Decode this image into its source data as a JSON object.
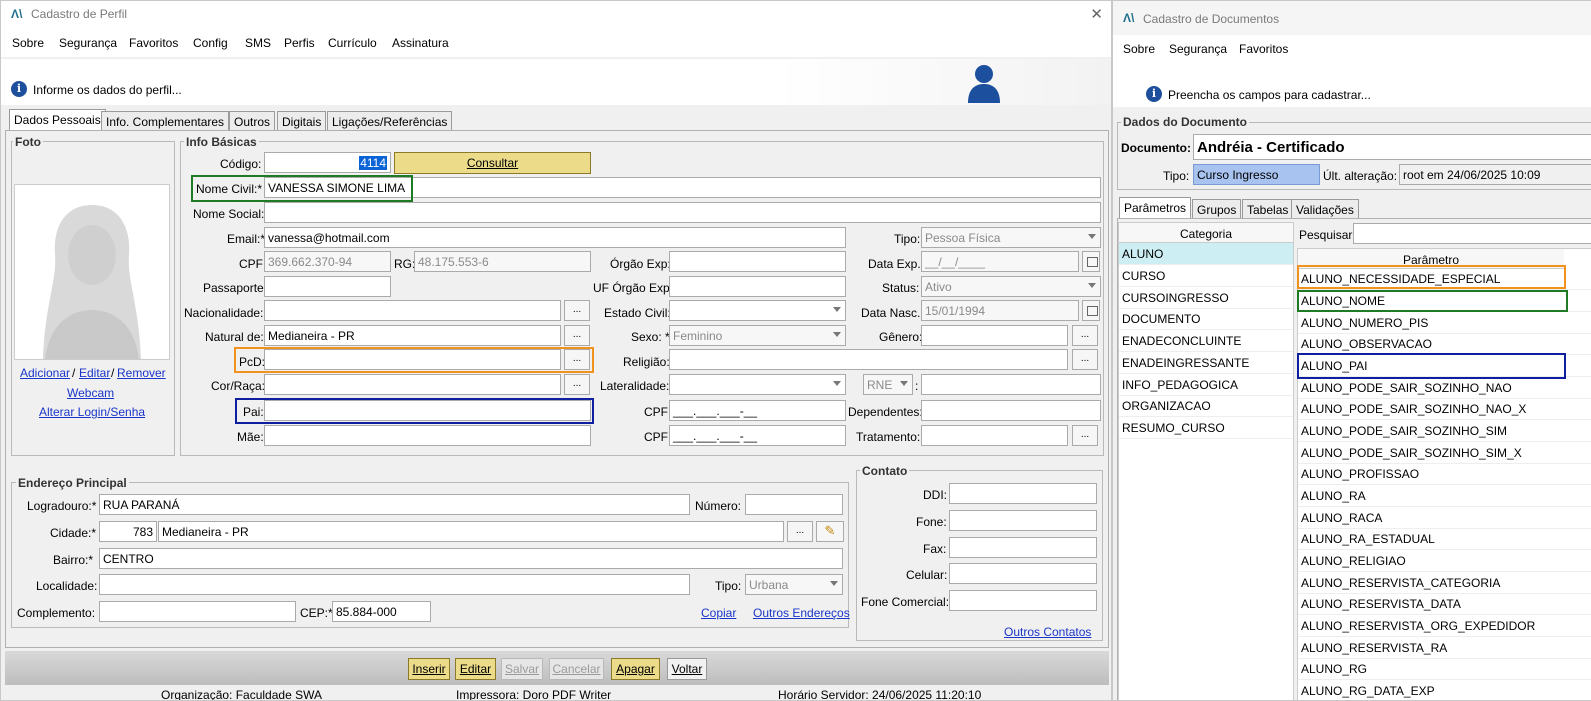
{
  "left_window": {
    "title": "Cadastro de Perfil",
    "logo": "Λ\\",
    "close": "✕",
    "menu": [
      "Sobre",
      "Segurança",
      "Favoritos",
      "Config",
      "SMS",
      "Perfis",
      "Currículo",
      "Assinatura"
    ],
    "info_text": "Informe os dados do perfil...",
    "tabs": [
      "Dados Pessoais",
      "Info. Complementares",
      "Outros",
      "Digitais",
      "Ligações/Referências"
    ],
    "foto": {
      "legend": "Foto",
      "links": {
        "adicionar": "Adicionar",
        "sep1": "/",
        "editar": "Editar",
        "sep2": "/",
        "remover": "Remover",
        "webcam": "Webcam",
        "alterar": "Alterar Login/Senha"
      }
    },
    "info_basicas": {
      "legend": "Info Básicas",
      "codigo_label": "Código:",
      "codigo_value": "4114",
      "consultar": "Consultar",
      "nome_civil_label": "Nome Civil:*",
      "nome_civil_value": "VANESSA SIMONE LIMA",
      "nome_social_label": "Nome Social:",
      "email_label": "Email:*",
      "email_value": "vanessa@hotmail.com",
      "tipo_label": "Tipo:",
      "tipo_value": "Pessoa Física",
      "cpf_label": "CPF:",
      "cpf_value": "369.662.370-94",
      "rg_label": "RG:",
      "rg_value": "48.175.553-6",
      "orgao_exp_label": "Órgão Exp:",
      "data_exp_label": "Data Exp.:",
      "data_exp_value": "__/__/____",
      "passaporte_label": "Passaporte:",
      "uf_orgao_label": "UF Órgão Exp:",
      "status_label": "Status:",
      "status_value": "Ativo",
      "nacionalidade_label": "Nacionalidade:",
      "estado_civil_label": "Estado Civil:",
      "data_nasc_label": "Data Nasc.:",
      "data_nasc_value": "15/01/1994",
      "natural_label": "Natural de:",
      "natural_value": "Medianeira - PR",
      "sexo_label": "Sexo: *",
      "sexo_value": "Feminino",
      "genero_label": "Gênero:",
      "pcd_label": "PcD:",
      "religiao_label": "Religião:",
      "cor_label": "Cor/Raça:",
      "lateralidade_label": "Lateralidade:",
      "rne_value": "RNE",
      "colon": ":",
      "pai_label": "Pai:",
      "cpf2_label": "CPF:",
      "cpf_mask": "___.___.___-__",
      "dependentes_label": "Dependentes:",
      "mae_label": "Mãe:",
      "cpf3_label": "CPF:",
      "tratamento_label": "Tratamento:",
      "dots": "..."
    },
    "endereco": {
      "legend": "Endereço Principal",
      "logradouro_label": "Logradouro:*",
      "logradouro_value": "RUA PARANÁ",
      "numero_label": "Número:",
      "cidade_label": "Cidade:*",
      "cidade_code": "783",
      "cidade_value": "Medianeira - PR",
      "bairro_label": "Bairro:*",
      "bairro_value": "CENTRO",
      "localidade_label": "Localidade:",
      "tipo_label": "Tipo:",
      "tipo_value": "Urbana",
      "complemento_label": "Complemento:",
      "cep_label": "CEP:*",
      "cep_value": "85.884-000",
      "copiar": "Copiar",
      "outros": "Outros Endereços"
    },
    "contato": {
      "legend": "Contato",
      "ddi": "DDI:",
      "fone": "Fone:",
      "fax": "Fax:",
      "celular": "Celular:",
      "fone_comercial": "Fone Comercial:",
      "outros": "Outros Contatos"
    },
    "buttons": {
      "inserir": "Inserir",
      "editar": "Editar",
      "salvar": "Salvar",
      "cancelar": "Cancelar",
      "apagar": "Apagar",
      "voltar": "Voltar"
    },
    "status_bar": {
      "org": "Organização: Faculdade SWA",
      "impressora": "Impressora: Doro PDF Writer",
      "horario": "Horário Servidor: 24/06/2025 11:20:10"
    }
  },
  "right_window": {
    "title": "Cadastro de Documentos",
    "logo": "Λ\\",
    "menu": [
      "Sobre",
      "Segurança",
      "Favoritos"
    ],
    "info_text": "Preencha os campos para cadastrar...",
    "dados_legend": "Dados do Documento",
    "documento_label": "Documento:",
    "documento_value": "Andréia - Certificado",
    "tipo_label": "Tipo:",
    "tipo_value": "Curso Ingresso",
    "ult_label": "Últ. alteração:",
    "ult_value": "root em 24/06/2025 10:09",
    "tabs": [
      "Parâmetros",
      "Grupos",
      "Tabelas",
      "Validações"
    ],
    "categoria_header": "Categoria",
    "categorias": [
      "ALUNO",
      "CURSO",
      "CURSOINGRESSO",
      "DOCUMENTO",
      "ENADECONCLUINTE",
      "ENADEINGRESSANTE",
      "INFO_PEDAGOGICA",
      "ORGANIZACAO",
      "RESUMO_CURSO"
    ],
    "pesquisar_label": "Pesquisar:",
    "parametro_header": "Parâmetro",
    "parametros": [
      "ALUNO_NECESSIDADE_ESPECIAL",
      "ALUNO_NOME",
      "ALUNO_NUMERO_PIS",
      "ALUNO_OBSERVACAO",
      "ALUNO_PAI",
      "ALUNO_PODE_SAIR_SOZINHO_NAO",
      "ALUNO_PODE_SAIR_SOZINHO_NAO_X",
      "ALUNO_PODE_SAIR_SOZINHO_SIM",
      "ALUNO_PODE_SAIR_SOZINHO_SIM_X",
      "ALUNO_PROFISSAO",
      "ALUNO_RA",
      "ALUNO_RACA",
      "ALUNO_RA_ESTADUAL",
      "ALUNO_RELIGIAO",
      "ALUNO_RESERVISTA_CATEGORIA",
      "ALUNO_RESERVISTA_DATA",
      "ALUNO_RESERVISTA_ORG_EXPEDIDOR",
      "ALUNO_RESERVISTA_RA",
      "ALUNO_RG",
      "ALUNO_RG_DATA_EXP"
    ]
  },
  "colors": {
    "highlight_green": "#1f7a24",
    "highlight_orange": "#f0921b",
    "highlight_blue": "#0d1f9e",
    "button_yellow": "#ecdc8a",
    "selection_blue": "#0a64d6"
  }
}
